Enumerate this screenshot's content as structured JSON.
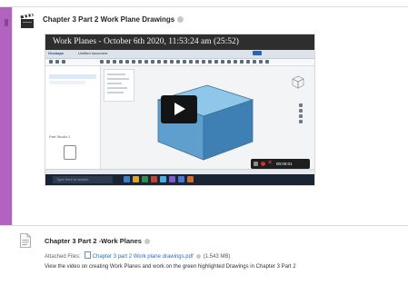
{
  "item1": {
    "title": "Chapter 3 Part 2 Work Plane Drawings",
    "video": {
      "overlay_title": "Work Planes - October 6th 2020, 11:53:24 am (25:52)",
      "app_name": "Onshape",
      "document_title": "Untitled document",
      "recorder_time": "00:00:01",
      "taskbar_search": "Type here to search",
      "part_label": "Part Studio 1"
    }
  },
  "item2": {
    "title": "Chapter 3 Part 2 -Work Planes",
    "attached_label": "Attached Files:",
    "file_name": "Chapter 3 part 2 Work plane drawings.pdf",
    "file_size": "(1.543 MB)",
    "description": "View the video on creating Work Planes and work on the green highlighted Drawings in Chapter 3 Part 2"
  },
  "colors": {
    "accent_bar": "#b163c0",
    "link": "#2a6ebb",
    "record_red": "#d32f2f"
  },
  "icons": {
    "item1": "video-clapper-icon",
    "item2": "document-icon",
    "visibility": "eye-icon",
    "play": "play-icon"
  }
}
